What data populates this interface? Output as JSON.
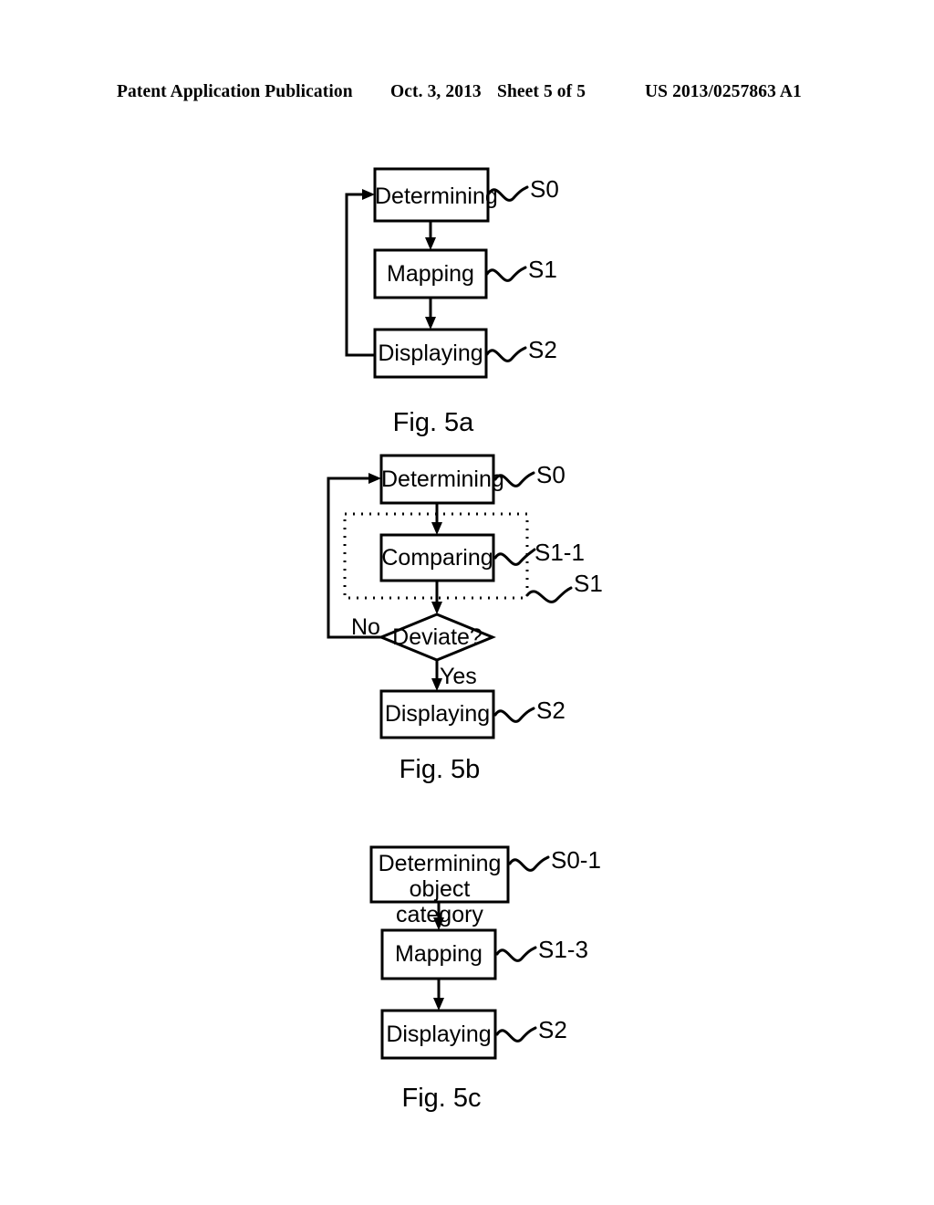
{
  "header": {
    "publication": "Patent Application Publication",
    "date": "Oct. 3, 2013",
    "sheet": "Sheet 5 of 5",
    "document_id": "US 2013/0257863 A1"
  },
  "figures": [
    {
      "id": "fig-5a",
      "caption": "Fig. 5a",
      "nodes": [
        {
          "id": "fig5a-determining",
          "label": "Determining",
          "shape": "process",
          "ref": "S0"
        },
        {
          "id": "fig5a-mapping",
          "label": "Mapping",
          "shape": "process",
          "ref": "S1"
        },
        {
          "id": "fig5a-displaying",
          "label": "Displaying",
          "shape": "process",
          "ref": "S2"
        }
      ],
      "edges": [
        {
          "from": "fig5a-determining",
          "to": "fig5a-mapping",
          "label": ""
        },
        {
          "from": "fig5a-mapping",
          "to": "fig5a-displaying",
          "label": ""
        },
        {
          "from": "fig5a-displaying",
          "to": "fig5a-determining",
          "label": "",
          "kind": "feedback"
        }
      ]
    },
    {
      "id": "fig-5b",
      "caption": "Fig. 5b",
      "nodes": [
        {
          "id": "fig5b-determining",
          "label": "Determining",
          "shape": "process",
          "ref": "S0"
        },
        {
          "id": "fig5b-comparing",
          "label": "Comparing",
          "shape": "process",
          "ref": "S1-1"
        },
        {
          "id": "fig5b-deviate",
          "label": "Deviate?",
          "shape": "decision",
          "ref": ""
        },
        {
          "id": "fig5b-displaying",
          "label": "Displaying",
          "shape": "process",
          "ref": "S2"
        }
      ],
      "groups": [
        {
          "id": "fig5b-group-s1",
          "ref": "S1",
          "style": "dotted",
          "contains": [
            "fig5b-comparing"
          ]
        }
      ],
      "edges": [
        {
          "from": "fig5b-determining",
          "to": "fig5b-comparing",
          "label": ""
        },
        {
          "from": "fig5b-comparing",
          "to": "fig5b-deviate",
          "label": ""
        },
        {
          "from": "fig5b-deviate",
          "to": "fig5b-displaying",
          "label": "Yes"
        },
        {
          "from": "fig5b-deviate",
          "to": "fig5b-determining",
          "label": "No",
          "kind": "feedback"
        }
      ]
    },
    {
      "id": "fig-5c",
      "caption": "Fig. 5c",
      "nodes": [
        {
          "id": "fig5c-determining",
          "label_line1": "Determining",
          "label_line2": "object category",
          "shape": "process",
          "ref": "S0-1"
        },
        {
          "id": "fig5c-mapping",
          "label": "Mapping",
          "shape": "process",
          "ref": "S1-3"
        },
        {
          "id": "fig5c-displaying",
          "label": "Displaying",
          "shape": "process",
          "ref": "S2"
        }
      ],
      "edges": [
        {
          "from": "fig5c-determining",
          "to": "fig5c-mapping",
          "label": ""
        },
        {
          "from": "fig5c-mapping",
          "to": "fig5c-displaying",
          "label": ""
        }
      ]
    }
  ],
  "colors": {
    "ink": "#000000",
    "paper": "#ffffff"
  }
}
